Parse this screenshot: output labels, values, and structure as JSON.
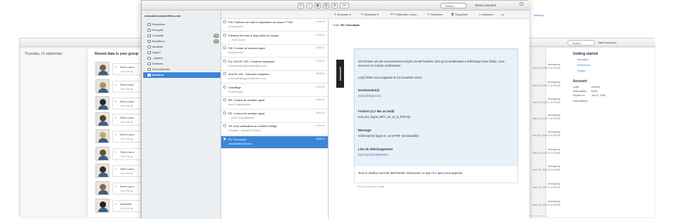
{
  "background": {
    "date": "Thursday, 19 september",
    "recent_title": "Recent data in your group",
    "items": [
      {
        "title": "Demo acco",
        "sub": "Join the gr"
      },
      {
        "title": "Demo acco",
        "sub": "Join the gr"
      },
      {
        "title": "Demo acco",
        "sub": "Join the gr"
      },
      {
        "title": "Demo acco",
        "sub": "Join the gr"
      },
      {
        "title": "Demo acco",
        "sub": "Join the gr"
      },
      {
        "title": "Demo acco",
        "sub": "Join the gr"
      },
      {
        "title": "Demo acco",
        "sub": "Join the gr"
      },
      {
        "title": "Demo acco",
        "sub": "Join the gr"
      },
      {
        "title": "Administr",
        "sub": "Join the gr"
      }
    ],
    "meta": [
      {
        "group": "demogroup",
        "date": "Sep 15, 2013 4:12:32 AM"
      },
      {
        "group": "demogroup",
        "date": "Sep 15, 2013 4:12:26 AM"
      },
      {
        "group": "demogroup",
        "date": "Sep 15, 2013 4:12:21 AM"
      },
      {
        "group": "demogroup",
        "date": "Sep 15, 2013 4:12:15 AM"
      },
      {
        "group": "demogroup",
        "date": "Sep 15, 2013 4:12:08 AM"
      },
      {
        "group": "demogroup",
        "date": "Sep 15, 2013 4:12:04 AM"
      },
      {
        "group": "demogroup",
        "date": "Sep 15, 2013 4:11:59 AM"
      },
      {
        "group": "demogroup",
        "date": "Sep 15, 2013 4:11:54 AM"
      },
      {
        "group": "demogroup",
        "date": "Sep 15, 2013 4:11:50 AM"
      }
    ],
    "settings": "Settings",
    "search": "Search",
    "account_menu": "Demo account",
    "getting_started": "Getting started",
    "gs_links": [
      "Messages",
      "Preferences",
      "Groups"
    ],
    "account_title": "Account",
    "account_rows": [
      {
        "k": "Login:",
        "v": "demoan"
      },
      {
        "k": "Subscription:",
        "v": "Demo"
      },
      {
        "k": "Expires on:",
        "v": "Jan 15, 2026"
      },
      {
        "k": "Subscriptions",
        "v": ""
      }
    ]
  },
  "window": {
    "search": "Search",
    "account_menu": "Demo account",
    "sidebar": {
      "account": "arnaud@contactoffice.com",
      "folders": [
        {
          "label": "Réception",
          "count": ""
        },
        {
          "label": "Envoyés",
          "count": ""
        },
        {
          "label": "Corbeille",
          "count": "41"
        },
        {
          "label": "Brouillons",
          "count": "17"
        },
        {
          "label": "Modèles",
          "count": ""
        },
        {
          "label": "Spam?",
          "count": ""
        },
        {
          "label": "_system",
          "count": ""
        },
        {
          "label": "Archives",
          "count": ""
        },
        {
          "label": "Bod systèmes",
          "count": ""
        },
        {
          "label": "Bureaux",
          "count": ""
        }
      ]
    },
    "toolbar": {
      "new": "Nouveau",
      "reply": "Répondre",
      "reply_all": "Répondre à tous",
      "forward": "Transférer",
      "delete": "Supprimer",
      "move": "Déplacer",
      "more": "•••"
    },
    "messages": [
      {
        "subject": "FW: Factures de mise à disposition de locaux ***AN",
        "from": "Arnaud Nuiet",
        "date": "24/02/11"
      },
      {
        "subject": "Factures de mise à disposition de locaux",
        "from": "→ Julien André",
        "date": "23/02/11"
      },
      {
        "subject": "FW: Contrat de location signé",
        "from": "Arnaud Nuiet",
        "date": "23/02/11"
      },
      {
        "subject": "Fw: HULPE 150 - Factures impayées",
        "from": "sofia.sotlil@bagosmaint-dore.com",
        "date": "17/02/11"
      },
      {
        "subject": "HULPE 150 - Factures impayées",
        "from": "sofia.sotlil@bagosmaint-dore.com",
        "date": "08/02/11"
      },
      {
        "subject": "Chauffage",
        "from": "Arnaud Nuiet",
        "date": "15/01/11"
      },
      {
        "subject": "RE: Contrat de location signé",
        "from": "Anne Vosaugibeebe",
        "date": "19/01/11"
      },
      {
        "subject": "RE: Contrat de location signé",
        "from": "→ Anne Vosaugibeebe",
        "date": "16/01/11"
      },
      {
        "subject": "TR: suivi publication au moniteur Belge",
        "from": "Complest - Alexandre Gérard",
        "date": "12/01/11"
      },
      {
        "subject": "Fw: Décompte",
        "from": "Jean-Baptiste Boutra",
        "date": "02/01/11"
      }
    ],
    "reading": {
      "subject_label": "Sujet:",
      "subject": "Re: Décompte",
      "badge": "wetransfer",
      "intro": "Vos fichiers ont été correctement envoyés via WeTransfer. Dès qu'un destinataire a téléchargé votre fichier, vous recevrez un mail de confirmation.",
      "deletion": "Le(s) fichier sera supprimé le 12 novembre 2013.",
      "recipients_h": "Destinataire(s)",
      "recipient": "home@skynet.be",
      "files_h": "Fichiers (3,7 Mo au total)",
      "files": "tous_les_logos_MFC_en_ai_et_PDF.zip",
      "message_h": "Message",
      "message": "Voilà tout les logos en .ai et PDF (vectorisable)",
      "link_h": "Lien de téléchargement",
      "link": "http://we.tl/1H00RX5Tx",
      "footer_text": "Tirez le meilleur parti de WeTransfer. Découvrez ce que",
      "footer_plus": "Plus",
      "footer_tail": "peut vous apporter.",
      "bottom_links": "Envoi   Questions   Légal"
    }
  }
}
